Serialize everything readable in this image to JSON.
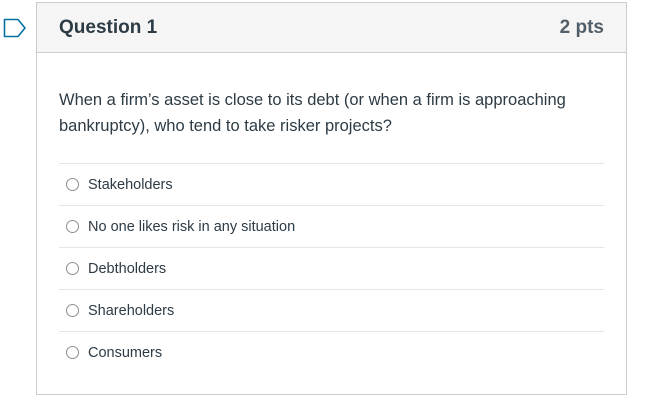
{
  "question": {
    "title": "Question 1",
    "points": "2 pts",
    "text": "When a firm’s asset is close to its debt (or when a firm is approaching bankruptcy), who tend to take risker projects?",
    "flag_icon": "bookmark-flag-icon",
    "accent_color": "#0770a3",
    "answers": [
      {
        "label": "Stakeholders",
        "selected": false
      },
      {
        "label": "No one likes risk in any situation",
        "selected": false
      },
      {
        "label": "Debtholders",
        "selected": false
      },
      {
        "label": "Shareholders",
        "selected": false
      },
      {
        "label": "Consumers",
        "selected": false
      }
    ]
  }
}
